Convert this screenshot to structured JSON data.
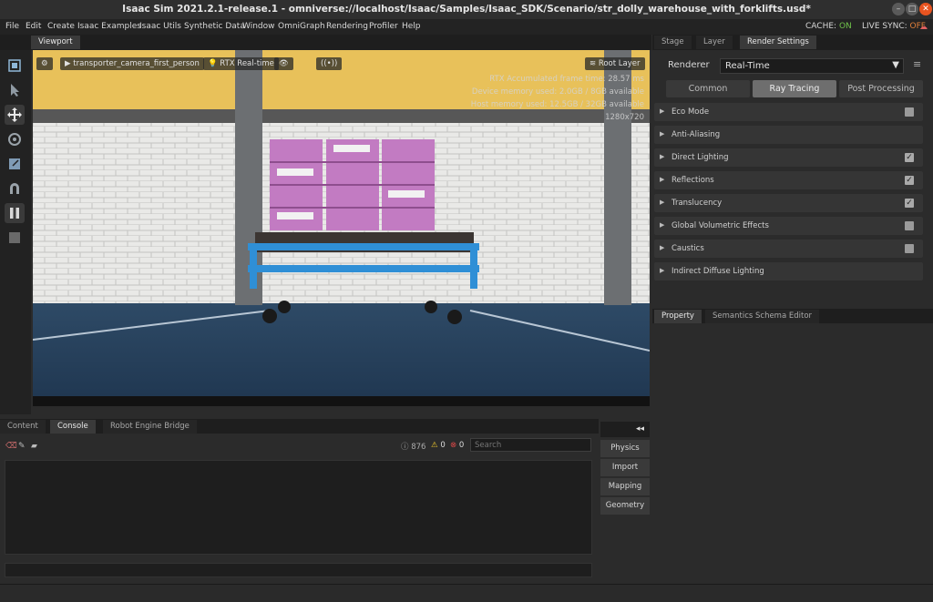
{
  "window": {
    "title": "Isaac Sim 2021.2.1-release.1 - omniverse://localhost/Isaac/Samples/Isaac_SDK/Scenario/str_dolly_warehouse_with_forklifts.usd*"
  },
  "menu": {
    "items": [
      "File",
      "Edit",
      "Create",
      "Isaac Examples",
      "Isaac Utils",
      "Synthetic Data",
      "Window",
      "OmniGraph",
      "Rendering",
      "Profiler",
      "Help"
    ],
    "cache_label": "CACHE:",
    "cache_value": "ON",
    "live_sync_label": "LIVE SYNC:",
    "live_sync_value": "OFF"
  },
  "viewport": {
    "tab": "Viewport",
    "camera": "transporter_camera_first_person",
    "render_mode": "RTX Real-time",
    "root_layer": "Root Layer",
    "stats": [
      "RTX Accumulated frame time: 28.57 ms",
      "Device memory used: 2.0GB /  8GB available",
      "Host memory used: 12.5GB / 32GB available",
      "1280x720"
    ]
  },
  "right_tabs": [
    "Stage",
    "Layer",
    "Render Settings"
  ],
  "render_settings": {
    "renderer_label": "Renderer",
    "renderer_value": "Real-Time",
    "subtabs": [
      "Common",
      "Ray Tracing",
      "Post Processing"
    ],
    "active_subtab": "Ray Tracing",
    "sections": [
      {
        "label": "Eco Mode",
        "checkbox": true,
        "checked": false
      },
      {
        "label": "Anti-Aliasing",
        "checkbox": false
      },
      {
        "label": "Direct Lighting",
        "checkbox": true,
        "checked": true
      },
      {
        "label": "Reflections",
        "checkbox": true,
        "checked": true
      },
      {
        "label": "Translucency",
        "checkbox": true,
        "checked": true
      },
      {
        "label": "Global Volumetric Effects",
        "checkbox": true,
        "checked": false
      },
      {
        "label": "Caustics",
        "checkbox": true,
        "checked": false
      },
      {
        "label": "Indirect Diffuse Lighting",
        "checkbox": false
      }
    ]
  },
  "property_tabs": [
    "Property",
    "Semantics Schema Editor"
  ],
  "bottom_tabs": [
    "Content",
    "Console",
    "Robot Engine Bridge"
  ],
  "console": {
    "info_count": "876",
    "warn_count": "0",
    "error_count": "0",
    "search_placeholder": "Search"
  },
  "side_buttons": [
    "Physics",
    "Import",
    "Mapping",
    "Geometry"
  ],
  "colors": {
    "accent_on": "#6fc24a",
    "accent_off": "#e07f3a"
  }
}
